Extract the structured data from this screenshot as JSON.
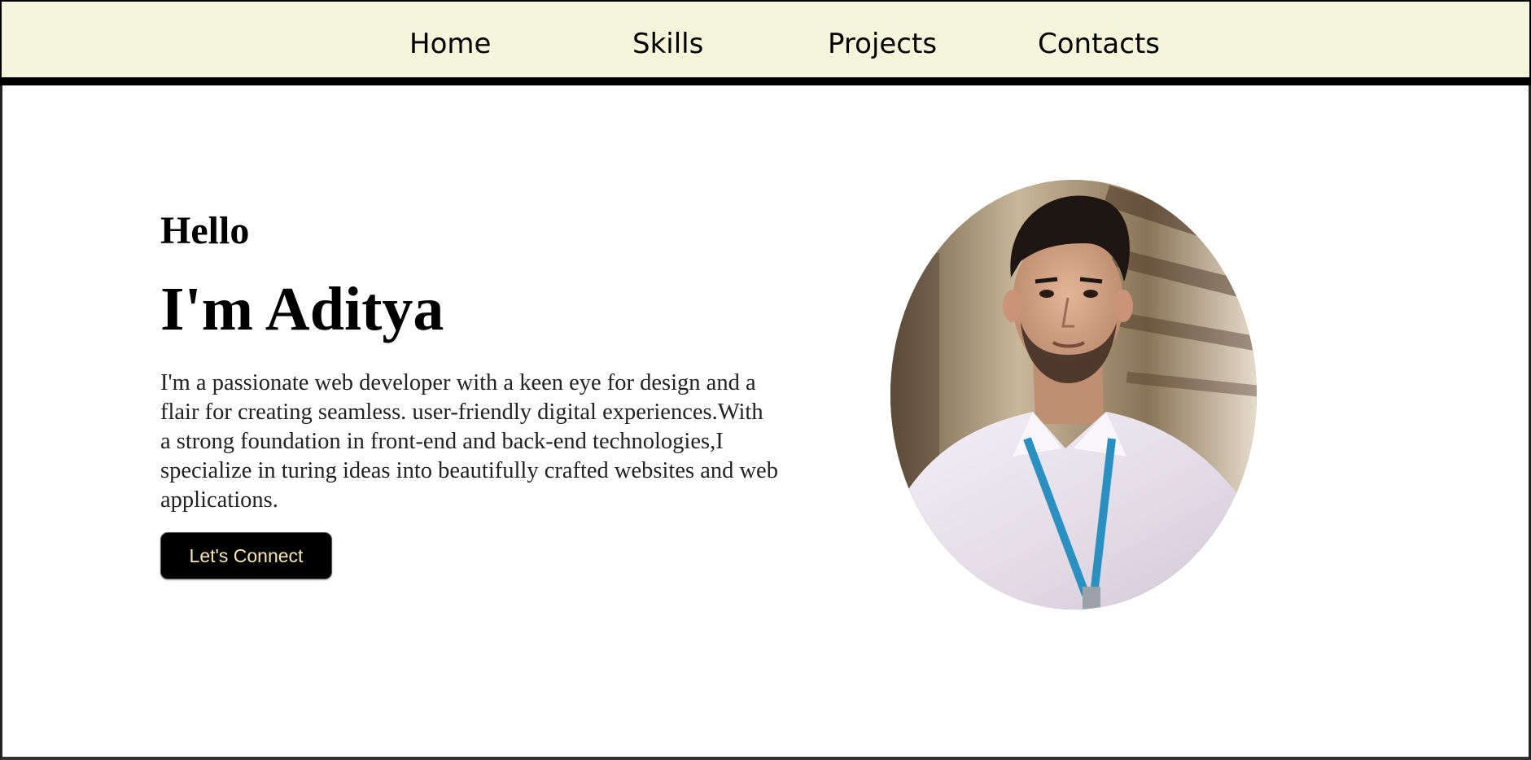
{
  "nav": {
    "items": [
      {
        "label": "Home"
      },
      {
        "label": "Skills"
      },
      {
        "label": "Projects"
      },
      {
        "label": "Contacts"
      }
    ]
  },
  "hero": {
    "greeting": "Hello",
    "name": "I'm Aditya",
    "bio": "I'm a passionate web developer with a keen eye for design and a flair for creating seamless. user-friendly digital experiences.With a strong foundation in front-end and back-end technologies,I specialize in turing ideas into beautifully crafted websites and web applications.",
    "cta_label": "Let's Connect",
    "portrait_icon": "profile-photo"
  },
  "colors": {
    "navbar_bg": "#f5f5dc",
    "button_bg": "#000000",
    "button_text": "#f9e6b8"
  }
}
